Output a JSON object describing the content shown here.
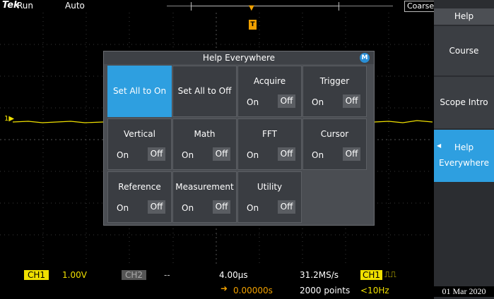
{
  "status": {
    "brand": "Tek",
    "acq_state": "Run",
    "trigger_mode": "Auto",
    "knob_mode": "Coarse"
  },
  "help_panel": {
    "title": "Help Everywhere",
    "badge": "M",
    "set_all_on": "Set All to On",
    "set_all_off": "Set All to Off",
    "on_label": "On",
    "off_label": "Off",
    "items": [
      "Acquire",
      "Trigger",
      "Vertical",
      "Math",
      "FFT",
      "Cursor",
      "Reference",
      "Measurement",
      "Utility"
    ]
  },
  "side_menu": {
    "title": "Help",
    "course": "Course",
    "scope_intro": "Scope Intro",
    "help_everywhere_line1": "Help",
    "help_everywhere_line2": "Everywhere",
    "date": "01 Mar 2020"
  },
  "readouts": {
    "ch1": "CH1",
    "ch1_scale": "1.00V",
    "ch2": "CH2",
    "ch2_scale": "--",
    "horizontal_scale": "4.00µs",
    "sample_rate": "31.2MS/s",
    "trigger_source": "CH1",
    "horizontal_position": "0.00000s",
    "record_length": "2000 points",
    "trigger_frequency": "<10Hz",
    "ch1_marker": "1"
  },
  "colors": {
    "accent": "#2e9fe0",
    "ch1": "#f0e000",
    "trigger": "#f0a000"
  }
}
